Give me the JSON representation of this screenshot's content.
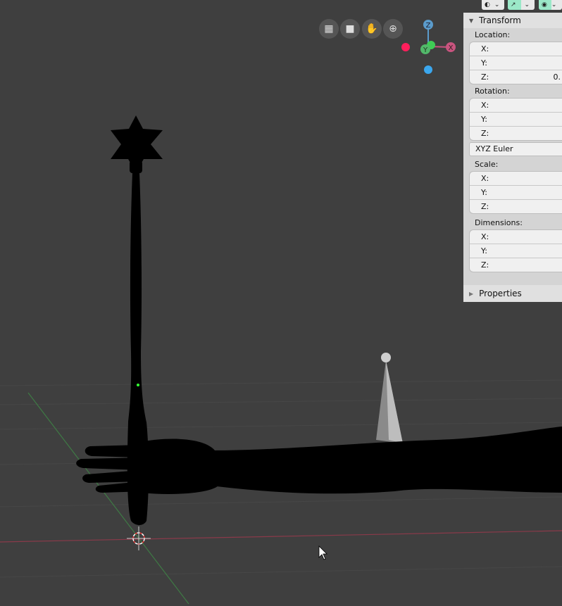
{
  "toolbar": {
    "buttons": [
      {
        "icon": "eye-cursor-icon"
      },
      {
        "icon": "manipulator-icon"
      },
      {
        "icon": "snap-icon"
      }
    ],
    "active_color": "#9be8c8"
  },
  "nav": {
    "buttons": [
      {
        "icon": "grid-view-icon"
      },
      {
        "icon": "camera-icon"
      },
      {
        "icon": "hand-pan-icon"
      },
      {
        "icon": "zoom-icon"
      }
    ]
  },
  "gizmo": {
    "z": "Z",
    "y": "Y",
    "x": "X",
    "colors": {
      "x": "#c9547f",
      "y": "#52b86a",
      "z": "#5b9ccc",
      "neg_x": "#ff1f5c",
      "neg_z": "#3ba7ee"
    }
  },
  "panel": {
    "transform_title": "Transform",
    "location_label": "Location:",
    "location": [
      {
        "axis": "X:",
        "value": ""
      },
      {
        "axis": "Y:",
        "value": ""
      },
      {
        "axis": "Z:",
        "value": "0."
      }
    ],
    "rotation_label": "Rotation:",
    "rotation": [
      {
        "axis": "X:"
      },
      {
        "axis": "Y:"
      },
      {
        "axis": "Z:"
      }
    ],
    "rotation_mode": "XYZ Euler",
    "scale_label": "Scale:",
    "scale": [
      {
        "axis": "X:"
      },
      {
        "axis": "Y:"
      },
      {
        "axis": "Z:"
      }
    ],
    "dimensions_label": "Dimensions:",
    "dimensions": [
      {
        "axis": "X:"
      },
      {
        "axis": "Y:"
      },
      {
        "axis": "Z:"
      }
    ],
    "properties_title": "Properties"
  }
}
